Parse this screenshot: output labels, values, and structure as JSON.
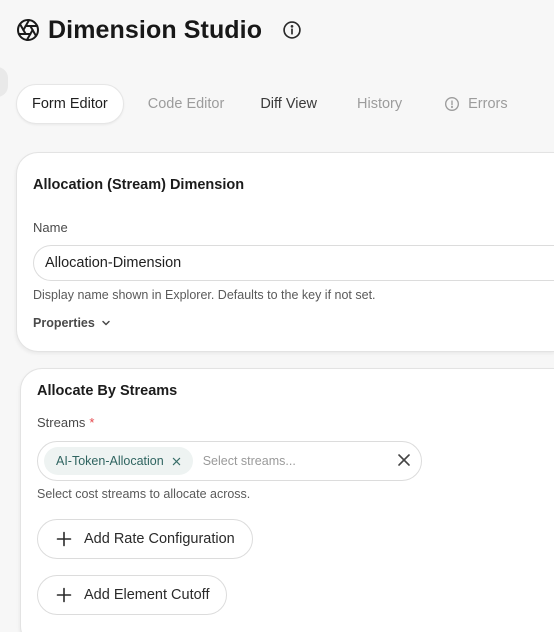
{
  "app": {
    "title": "Dimension Studio"
  },
  "tabs": [
    {
      "label": "Form Editor"
    },
    {
      "label": "Code Editor"
    },
    {
      "label": "Diff View"
    },
    {
      "label": "History"
    },
    {
      "label": "Errors"
    }
  ],
  "dimension_card": {
    "title": "Allocation (Stream) Dimension",
    "name_label": "Name",
    "name_value": "Allocation-Dimension",
    "name_help": "Display name shown in Explorer. Defaults to the key if not set.",
    "properties_label": "Properties"
  },
  "streams_card": {
    "title": "Allocate By Streams",
    "streams_label": "Streams",
    "required_mark": "*",
    "selected_stream": "AI-Token-Allocation",
    "placeholder": "Select streams...",
    "streams_help": "Select cost streams to allocate across.",
    "add_rate_label": "Add Rate Configuration",
    "add_cutoff_label": "Add Element Cutoff"
  },
  "colors": {
    "required": "#e5484d",
    "chip_bg": "#eef3f2",
    "chip_text": "#2f6460"
  }
}
